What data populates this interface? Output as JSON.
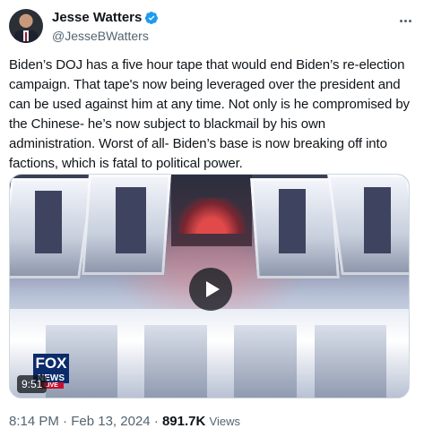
{
  "author": {
    "display_name": "Jesse Watters",
    "handle": "@JesseBWatters",
    "verified": true,
    "verified_color": "#1d9bf0"
  },
  "tweet": {
    "text": "Biden’s DOJ has a five hour tape that would end Biden’s re-election campaign. That tape's now being leveraged over the president and can be used against him at any time. Not only is he compromised by the Chinese- he’s now subject to blackmail by his own administration. Worst of all- Biden’s base is now breaking off into factions, which is fatal to political power."
  },
  "media": {
    "type": "video",
    "duration": "9:51",
    "logo_top": "FOX",
    "logo_middle": "NEWS",
    "logo_bottom": "LIVE",
    "play_icon": "play-icon"
  },
  "meta": {
    "time": "8:14 PM",
    "separator": " · ",
    "date": "Feb 13, 2024",
    "views_count": "891.7K",
    "views_label": "Views"
  },
  "icons": {
    "more": "more-options-icon",
    "verified": "verified-badge-icon"
  }
}
